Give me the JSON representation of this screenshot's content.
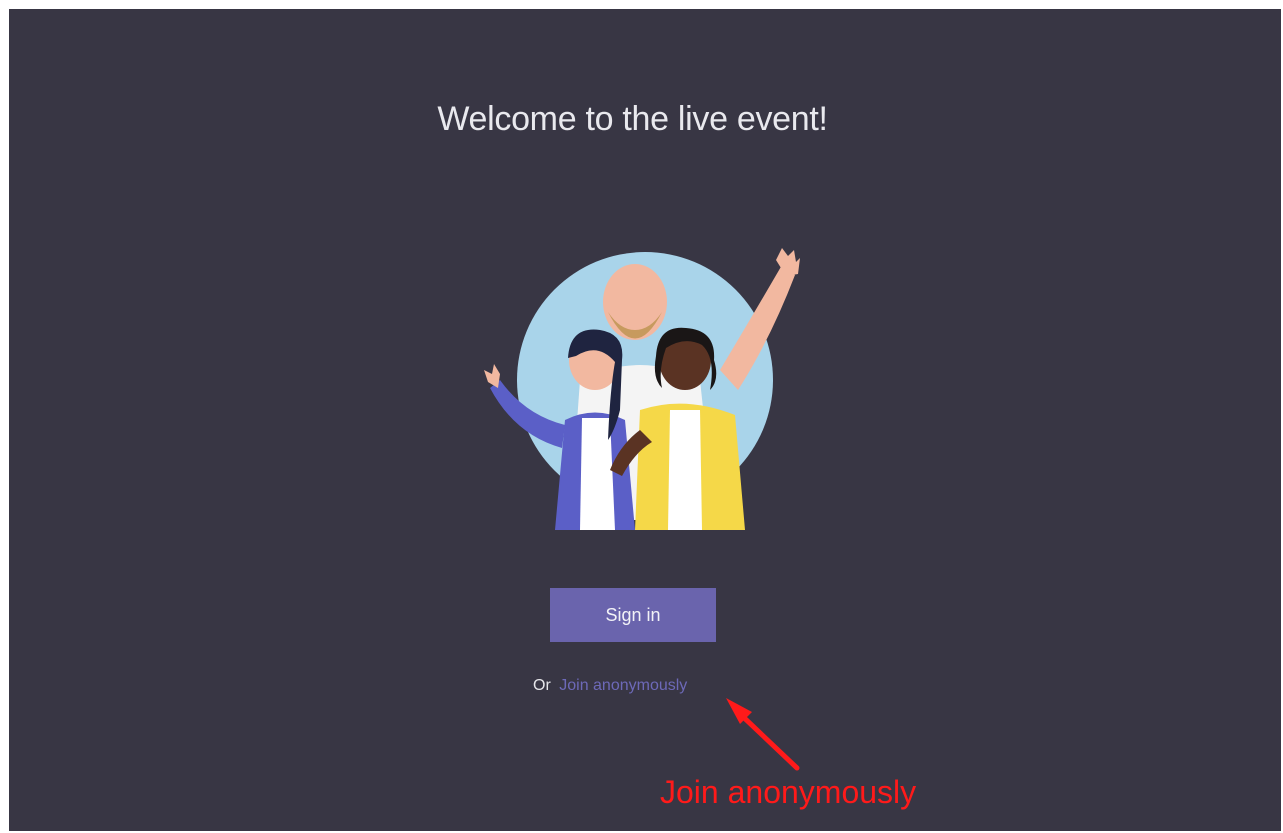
{
  "welcome": {
    "title": "Welcome to the live event!"
  },
  "illustration": {
    "name": "people-waving-illustration",
    "colors": {
      "circle": "#a9d4ea",
      "purple_jacket": "#5b5fc7",
      "yellow_jacket": "#f5d848",
      "white_shirt": "#f4f4f4",
      "skin_light": "#f2b8a0",
      "skin_dark": "#5a3323",
      "hair_dark": "#1f2440",
      "beard": "#c79a5e"
    }
  },
  "actions": {
    "signin_label": "Sign in",
    "or_text": "Or",
    "join_label": "Join anonymously"
  },
  "annotation": {
    "label": "Join anonymously",
    "color": "#ff1a1a"
  },
  "colors": {
    "background": "#383644",
    "accent": "#6a64ad",
    "link": "#6d69b8",
    "text": "#e9e9ee"
  }
}
